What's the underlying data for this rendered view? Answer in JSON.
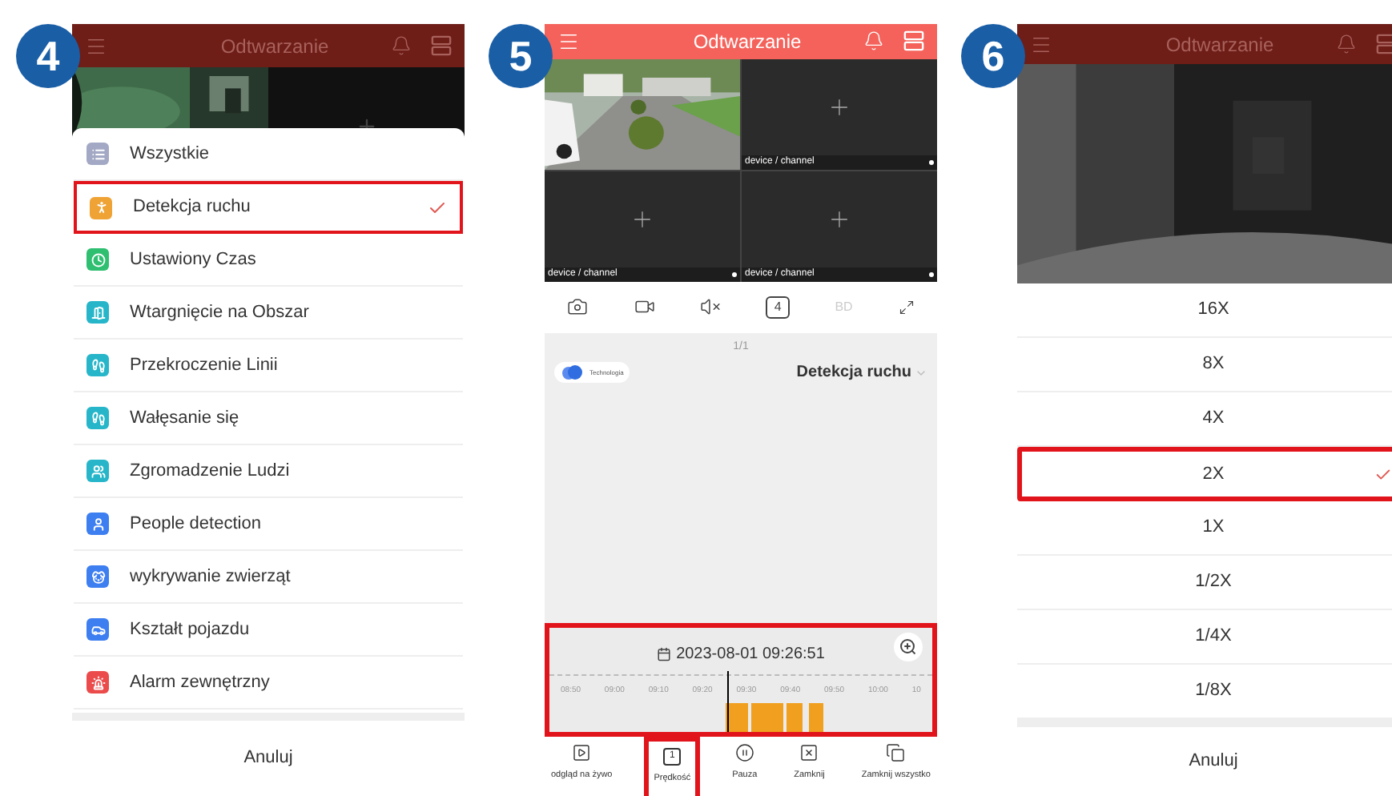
{
  "step_4": {
    "number": "4",
    "dimmed": true,
    "header": {
      "title": "Odtwarzanie"
    },
    "event_types": [
      {
        "label": "Wszystkie",
        "kind": "all",
        "color": "#a3a9c4",
        "selected": false
      },
      {
        "label": "Detekcja ruchu",
        "kind": "motion",
        "color": "#f0a335",
        "selected": true
      },
      {
        "label": "Ustawiony Czas",
        "kind": "time",
        "color": "#2fbf71",
        "selected": false
      },
      {
        "label": "Wtargnięcie na Obszar",
        "kind": "intrusion",
        "color": "#27b6c9",
        "selected": false
      },
      {
        "label": "Przekroczenie Linii",
        "kind": "line",
        "color": "#27b6c9",
        "selected": false
      },
      {
        "label": "Wałęsanie się",
        "kind": "loiter",
        "color": "#27b6c9",
        "selected": false
      },
      {
        "label": "Zgromadzenie Ludzi",
        "kind": "crowd",
        "color": "#27b6c9",
        "selected": false
      },
      {
        "label": "People detection",
        "kind": "people",
        "color": "#3d7ef0",
        "selected": false
      },
      {
        "label": "wykrywanie zwierząt",
        "kind": "animal",
        "color": "#3d7ef0",
        "selected": false
      },
      {
        "label": "Kształt pojazdu",
        "kind": "vehicle",
        "color": "#3d7ef0",
        "selected": false
      },
      {
        "label": "Alarm zewnętrzny",
        "kind": "alarm",
        "color": "#ec4b4b",
        "selected": false
      }
    ],
    "cancel": "Anuluj"
  },
  "step_5": {
    "number": "5",
    "dimmed": false,
    "header": {
      "title": "Odtwarzanie"
    },
    "cells": [
      {
        "kind": "picture"
      },
      {
        "kind": "empty",
        "label": "device / channel"
      },
      {
        "kind": "empty",
        "label": "device / channel"
      },
      {
        "kind": "empty",
        "label": "device / channel"
      }
    ],
    "split_count": "4",
    "quality": "BD",
    "page": "1/1",
    "cloud_chip": "Technologia",
    "event_filter": "Detekcja ruchu",
    "timeline": {
      "highlighted": true,
      "datetime": "2023-08-01 09:26:51",
      "ticks": [
        "08:50",
        "09:00",
        "09:10",
        "09:20",
        "09:30",
        "09:40",
        "09:50",
        "10:00",
        "10"
      ]
    },
    "actions": [
      {
        "kind": "live",
        "label": "odgląd na żywo",
        "highlighted": false
      },
      {
        "kind": "speed",
        "label": "Prędkość",
        "icon_text": "1",
        "highlighted": true
      },
      {
        "kind": "pause",
        "label": "Pauza",
        "highlighted": false
      },
      {
        "kind": "close",
        "label": "Zamknij",
        "highlighted": false
      },
      {
        "kind": "close_all",
        "label": "Zamknij wszystko",
        "highlighted": false
      }
    ]
  },
  "step_6": {
    "number": "6",
    "dimmed": true,
    "header": {
      "title": "Odtwarzanie"
    },
    "speeds": [
      {
        "label": "16X",
        "selected": false
      },
      {
        "label": "8X",
        "selected": false
      },
      {
        "label": "4X",
        "selected": false
      },
      {
        "label": "2X",
        "selected": true
      },
      {
        "label": "1X",
        "selected": false
      },
      {
        "label": "1/2X",
        "selected": false
      },
      {
        "label": "1/4X",
        "selected": false
      },
      {
        "label": "1/8X",
        "selected": false
      }
    ],
    "cancel": "Anuluj"
  }
}
